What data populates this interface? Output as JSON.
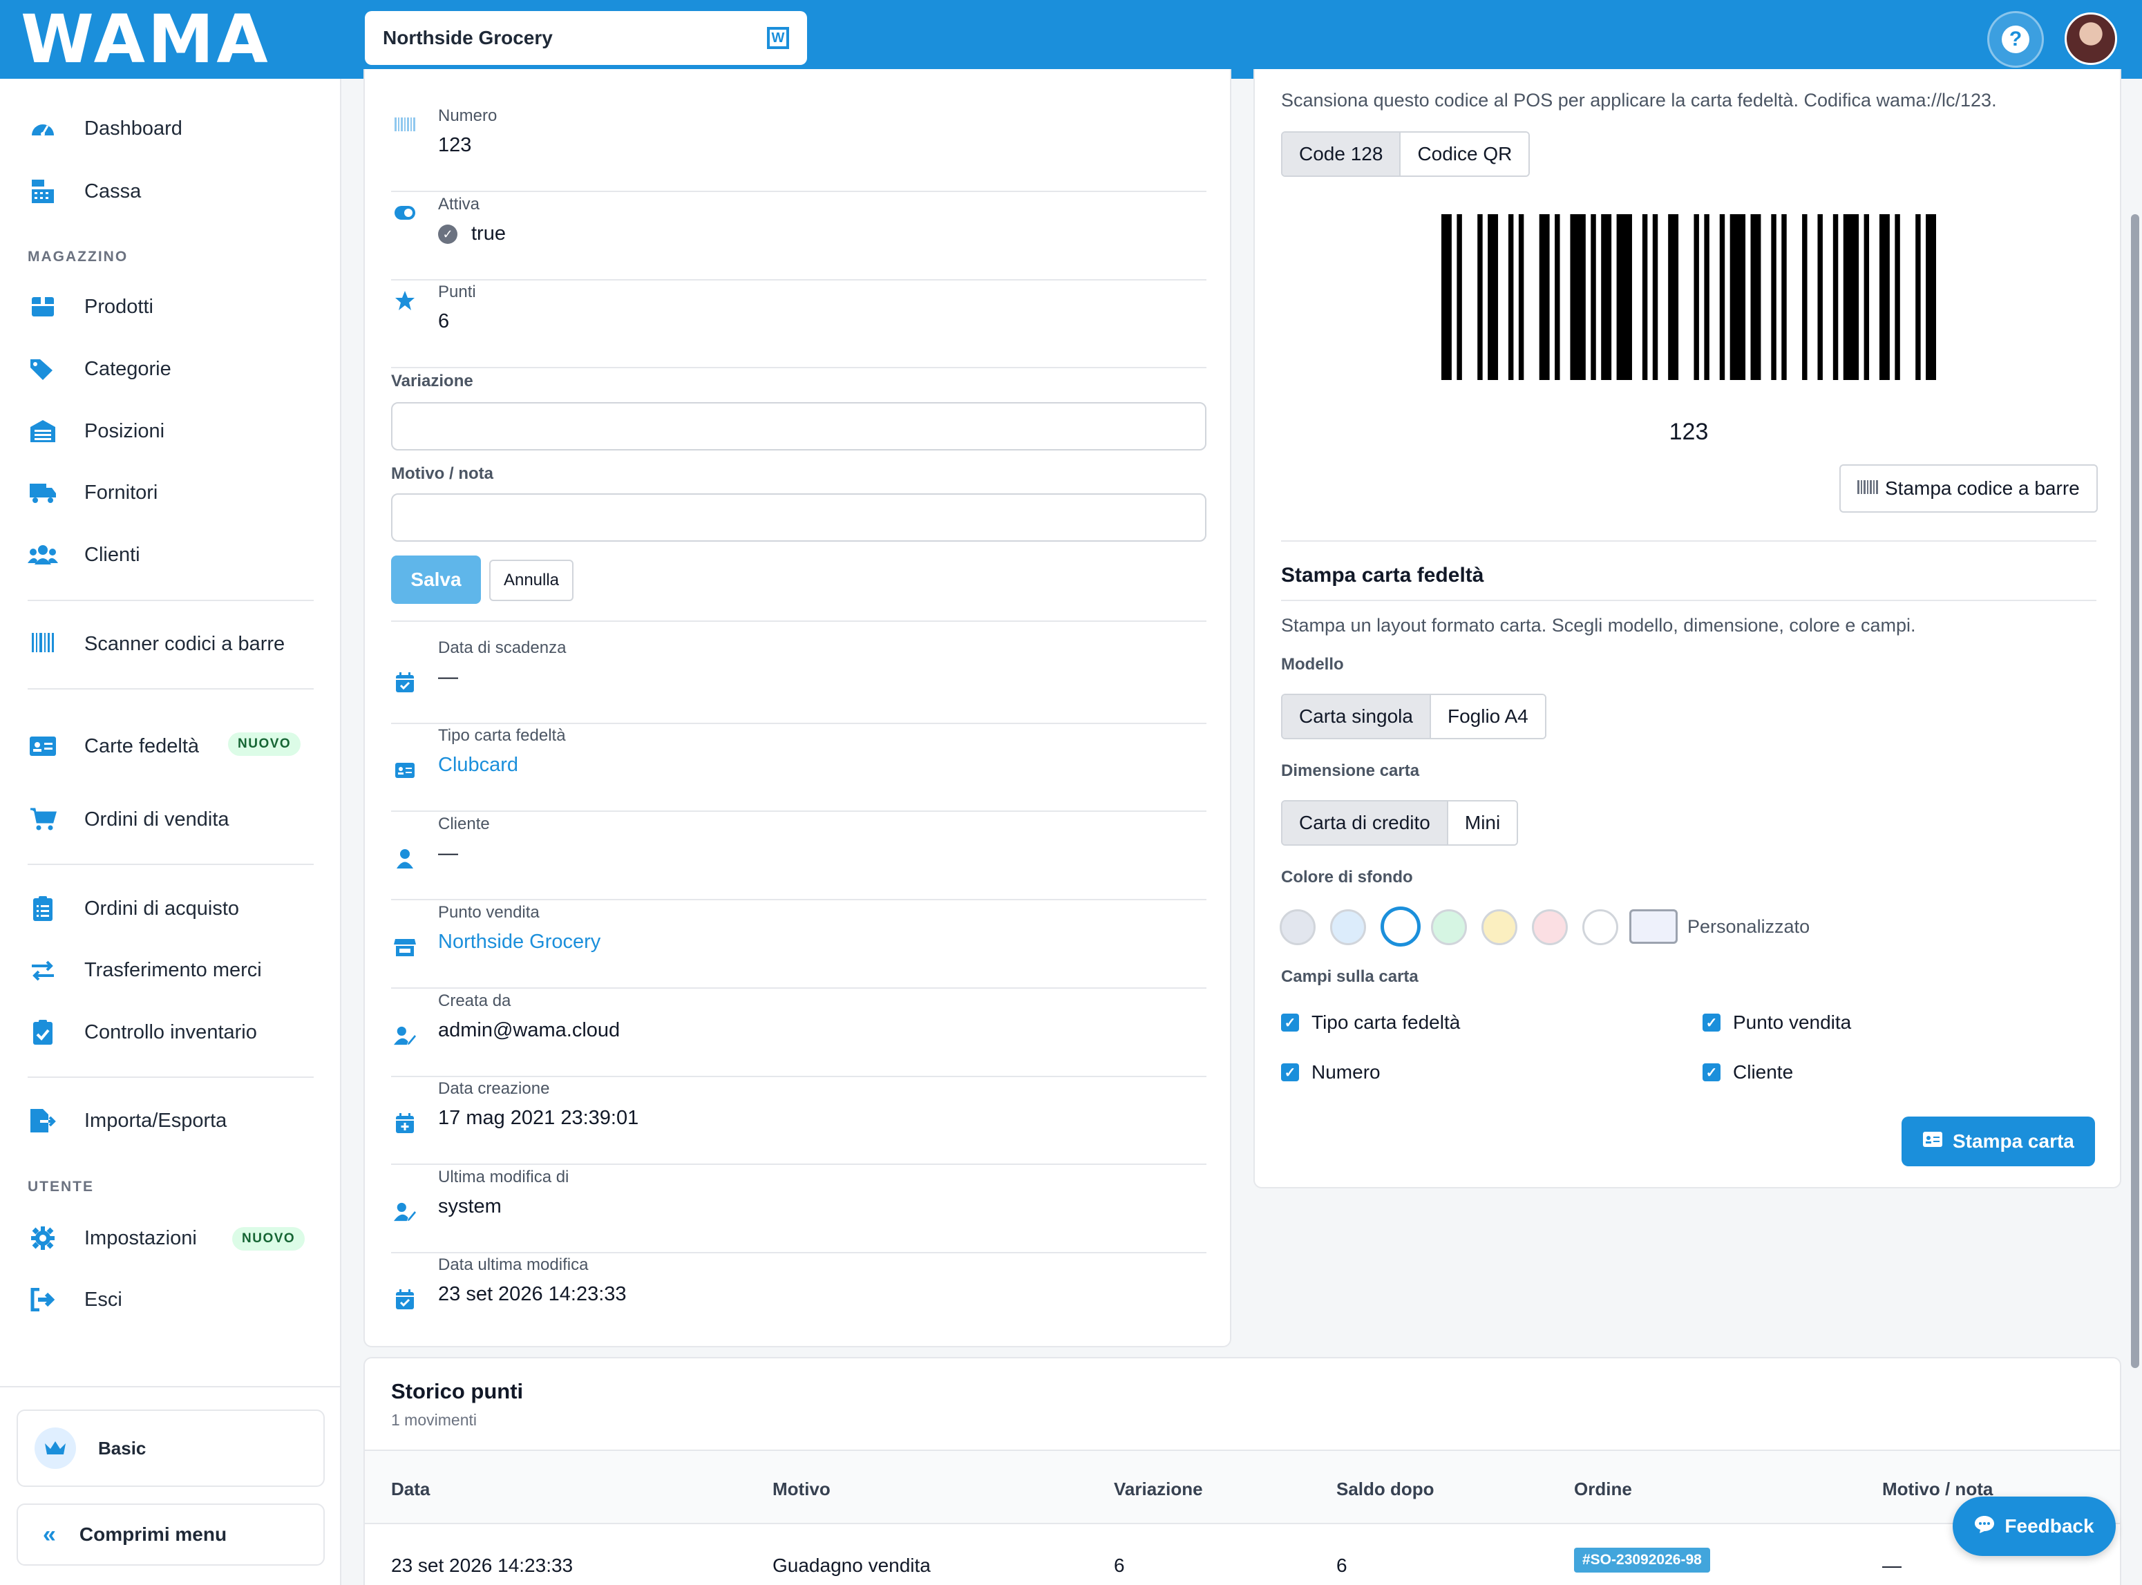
{
  "app": {
    "logo": "WAMA",
    "store": "Northside Grocery"
  },
  "sidebar": {
    "items_top": [
      {
        "label": "Dashboard",
        "icon": "dashboard-icon"
      },
      {
        "label": "Cassa",
        "icon": "cash-register-icon"
      }
    ],
    "section_magazzino": "MAGAZZINO",
    "items_magazzino": [
      {
        "label": "Prodotti",
        "icon": "box-icon"
      },
      {
        "label": "Categorie",
        "icon": "tags-icon"
      },
      {
        "label": "Posizioni",
        "icon": "warehouse-icon"
      },
      {
        "label": "Fornitori",
        "icon": "truck-icon"
      },
      {
        "label": "Clienti",
        "icon": "users-icon"
      }
    ],
    "scanner": "Scanner codici a barre",
    "loyalty": "Carte fedeltà",
    "loyalty_badge": "NUOVO",
    "sales_orders": "Ordini di vendita",
    "purchase_orders": "Ordini di acquisto",
    "transfers": "Trasferimento merci",
    "inventory": "Controllo inventario",
    "import_export": "Importa/Esporta",
    "section_utente": "UTENTE",
    "settings": "Impostazioni",
    "settings_badge": "NUOVO",
    "logout": "Esci",
    "plan": "Basic",
    "collapse": "Comprimi menu"
  },
  "detail": {
    "numero_label": "Numero",
    "numero": "123",
    "attiva_label": "Attiva",
    "attiva": "true",
    "punti_label": "Punti",
    "punti": "6",
    "variazione_label": "Variazione",
    "motivo_label": "Motivo / nota",
    "save": "Salva",
    "cancel": "Annulla",
    "scadenza_label": "Data di scadenza",
    "scadenza": "—",
    "tipo_label": "Tipo carta fedeltà",
    "tipo": "Clubcard",
    "cliente_label": "Cliente",
    "cliente": "—",
    "pv_label": "Punto vendita",
    "pv": "Northside Grocery",
    "creata_label": "Creata da",
    "creata": "admin@wama.cloud",
    "data_creazione_label": "Data creazione",
    "data_creazione": "17 mag 2021 23:39:01",
    "ultima_mod_label": "Ultima modifica di",
    "ultima_mod": "system",
    "data_ultima_label": "Data ultima modifica",
    "data_ultima": "23 set 2026 14:23:33"
  },
  "barcode": {
    "desc": "Scansiona questo codice al POS per applicare la carta fedeltà. Codifica wama://lc/123.",
    "opt_code128": "Code 128",
    "opt_qr": "Codice QR",
    "value": "123",
    "print": "Stampa codice a barre"
  },
  "print_card": {
    "title": "Stampa carta fedeltà",
    "desc": "Stampa un layout formato carta. Scegli modello, dimensione, colore e campi.",
    "modello_label": "Modello",
    "modello_opts": [
      "Carta singola",
      "Foglio A4"
    ],
    "dim_label": "Dimensione carta",
    "dim_opts": [
      "Carta di credito",
      "Mini"
    ],
    "colore_label": "Colore di sfondo",
    "colors": [
      "#e2e6ee",
      "#dcecfb",
      "#ffffff",
      "#d6f5e3",
      "#fbefc0",
      "#fbdfe3",
      "#ffffff"
    ],
    "custom": "Personalizzato",
    "campi_label": "Campi sulla carta",
    "campi": [
      "Tipo carta fedeltà",
      "Punto vendita",
      "Numero",
      "Cliente"
    ],
    "print": "Stampa carta"
  },
  "history": {
    "title": "Storico punti",
    "subtitle": "1 movimenti",
    "columns": [
      "Data",
      "Motivo",
      "Variazione",
      "Saldo dopo",
      "Ordine",
      "Motivo / nota"
    ],
    "row": {
      "data": "23 set 2026 14:23:33",
      "motivo": "Guadagno vendita",
      "variazione": "6",
      "saldo": "6",
      "ordine": "#SO-23092026-98",
      "nota": "—"
    }
  },
  "feedback": "Feedback"
}
